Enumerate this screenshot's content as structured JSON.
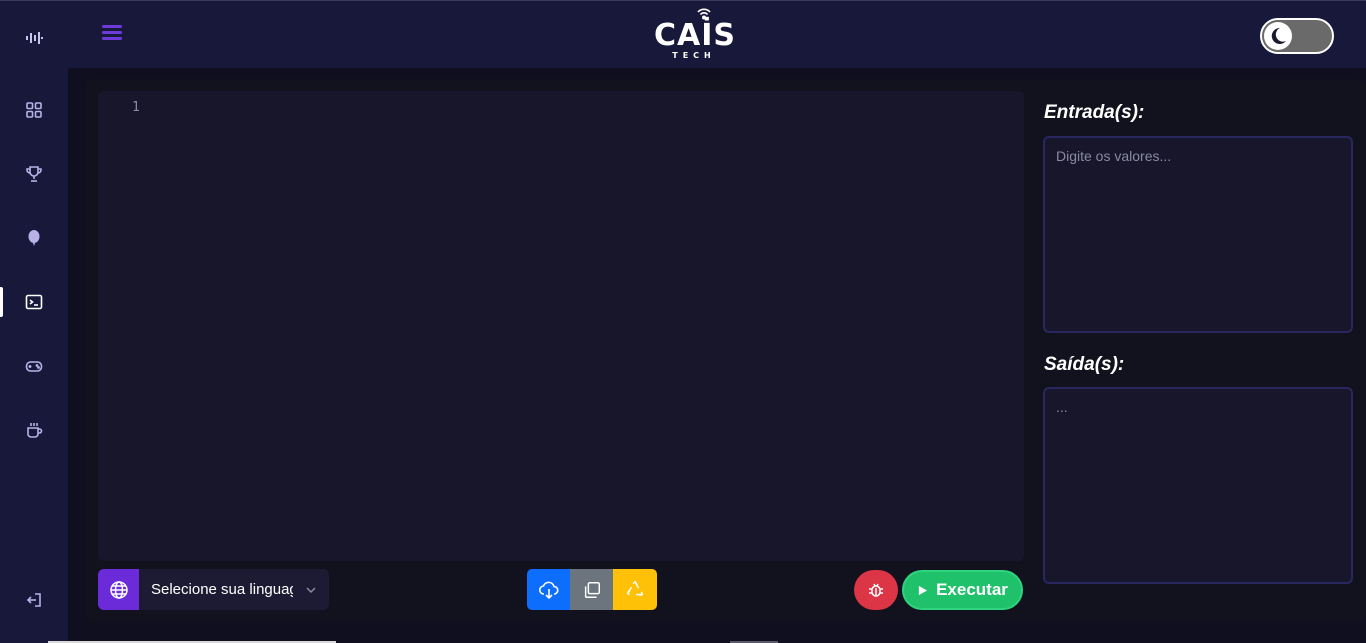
{
  "sidebar": {
    "items": [
      {
        "name": "waveform-icon"
      },
      {
        "name": "dashboard-grid-icon"
      },
      {
        "name": "trophy-icon"
      },
      {
        "name": "balloon-icon"
      },
      {
        "name": "terminal-icon",
        "active": true
      },
      {
        "name": "gamepad-icon"
      },
      {
        "name": "coffee-cup-icon"
      },
      {
        "name": "logout-icon"
      }
    ]
  },
  "header": {
    "logo_main": "CAİS",
    "logo_sub": "TECH",
    "theme_toggle": "dark-mode-moon-icon"
  },
  "editor": {
    "line_numbers": [
      "1"
    ],
    "language_placeholder": "Selecione sua linguagem",
    "run_label": "Executar"
  },
  "io": {
    "input_title": "Entrada(s):",
    "input_placeholder": "Digite os valores...",
    "output_title": "Saída(s):",
    "output_value": "..."
  },
  "colors": {
    "accent": "#6c2bd9",
    "upload": "#0d6efd",
    "copy": "#6c757d",
    "recycle": "#ffc107",
    "debug": "#dc3545",
    "run": "#20c16b"
  }
}
